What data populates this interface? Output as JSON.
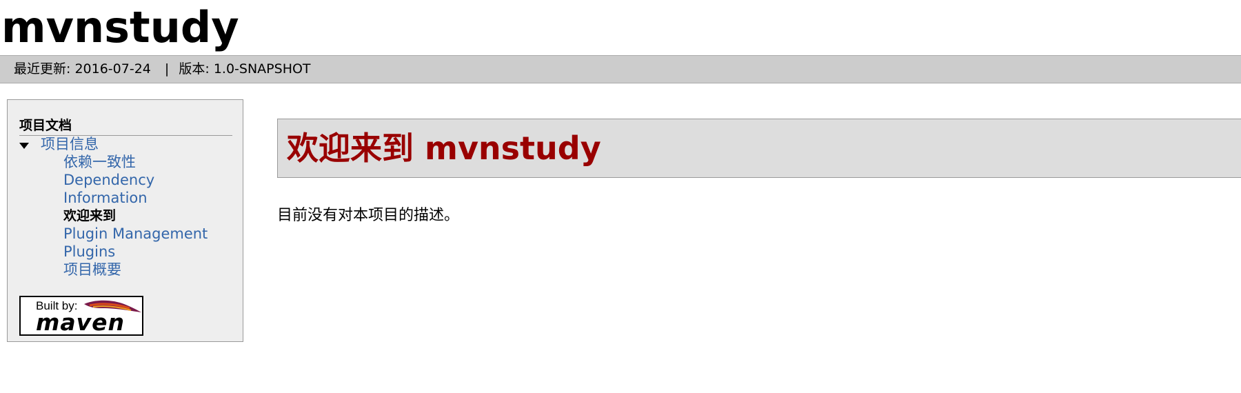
{
  "banner": {
    "title": "mvnstudy"
  },
  "breadcrumbs": {
    "last_updated_label": "最近更新:",
    "last_updated": "2016-07-24",
    "separator": "|",
    "version_label": "版本:",
    "version": "1.0-SNAPSHOT"
  },
  "sidebar": {
    "heading": "项目文档",
    "section": {
      "label": "项目信息",
      "expanded": true,
      "items": [
        {
          "label": "依赖一致性",
          "selected": false
        },
        {
          "label": "Dependency",
          "selected": false
        },
        {
          "label": "Information",
          "selected": false
        },
        {
          "label": "欢迎来到",
          "selected": true
        },
        {
          "label": "Plugin Management",
          "selected": false
        },
        {
          "label": "Plugins",
          "selected": false
        },
        {
          "label": "项目概要",
          "selected": false
        }
      ]
    },
    "badge": {
      "built_by": "Built by:",
      "brand": "maven"
    }
  },
  "main": {
    "title": "欢迎来到 mvnstudy",
    "description": "目前没有对本项目的描述。"
  },
  "colors": {
    "link": "#3366aa",
    "heading_red": "#990000",
    "breadcrumb_bar": "#cccccc",
    "sidebar_bg": "#eeeeee",
    "title_box_bg": "#dddddd"
  }
}
